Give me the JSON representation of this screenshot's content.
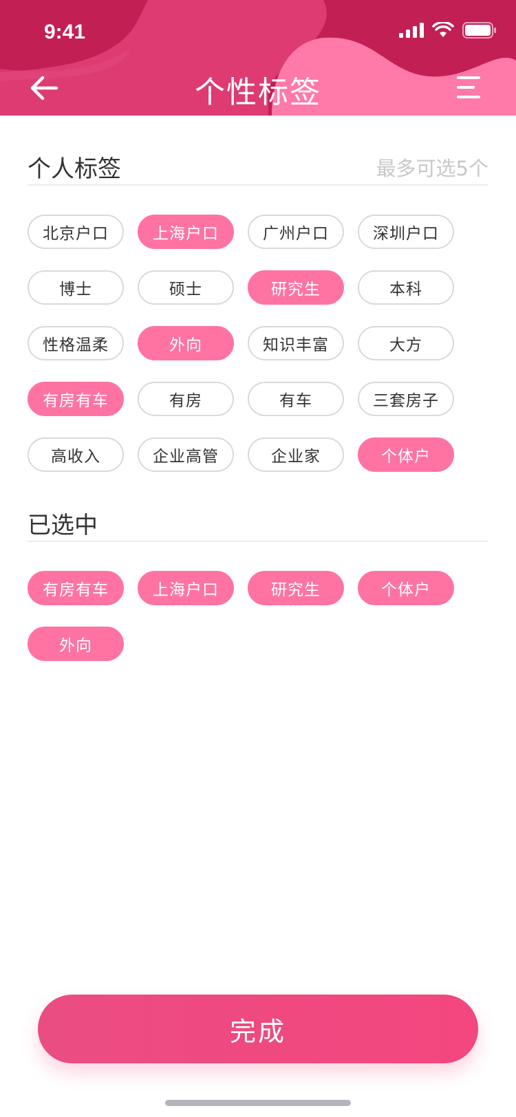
{
  "status_bar": {
    "time": "9:41"
  },
  "nav": {
    "title": "个性标签",
    "back_icon": "arrow-left-icon",
    "menu_icon": "menu-icon"
  },
  "colors": {
    "header_dark": "#c21f55",
    "header_mid": "#de3b73",
    "header_light": "#ff7aa8",
    "tag_selected": "#ff73a3",
    "button": "#ef4a80"
  },
  "personal": {
    "title": "个人标签",
    "hint": "最多可选5个",
    "tags": [
      {
        "label": "北京户口",
        "selected": false
      },
      {
        "label": "上海户口",
        "selected": true
      },
      {
        "label": "广州户口",
        "selected": false
      },
      {
        "label": "深圳户口",
        "selected": false
      },
      {
        "label": "博士",
        "selected": false
      },
      {
        "label": "硕士",
        "selected": false
      },
      {
        "label": "研究生",
        "selected": true
      },
      {
        "label": "本科",
        "selected": false
      },
      {
        "label": "性格温柔",
        "selected": false
      },
      {
        "label": "外向",
        "selected": true
      },
      {
        "label": "知识丰富",
        "selected": false
      },
      {
        "label": "大方",
        "selected": false
      },
      {
        "label": "有房有车",
        "selected": true
      },
      {
        "label": "有房",
        "selected": false
      },
      {
        "label": "有车",
        "selected": false
      },
      {
        "label": "三套房子",
        "selected": false
      },
      {
        "label": "高收入",
        "selected": false
      },
      {
        "label": "企业高管",
        "selected": false
      },
      {
        "label": "企业家",
        "selected": false
      },
      {
        "label": "个体户",
        "selected": true
      }
    ]
  },
  "selected": {
    "title": "已选中",
    "tags": [
      {
        "label": "有房有车"
      },
      {
        "label": "上海户口"
      },
      {
        "label": "研究生"
      },
      {
        "label": "个体户"
      },
      {
        "label": "外向"
      }
    ]
  },
  "done_button": {
    "label": "完成"
  }
}
